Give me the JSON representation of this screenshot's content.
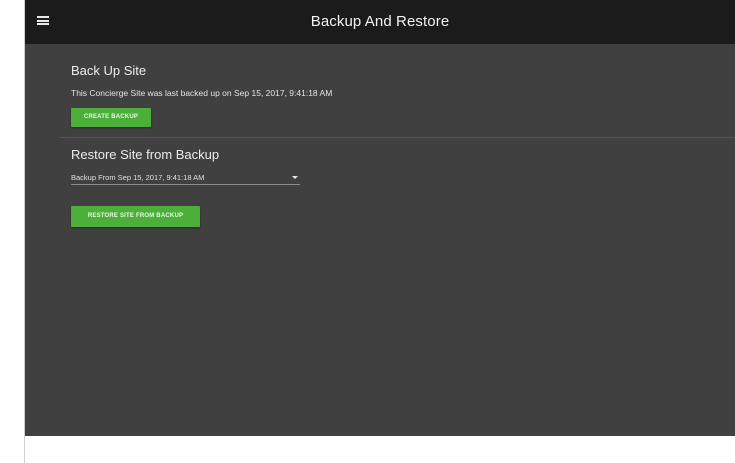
{
  "appbar": {
    "title": "Backup And Restore"
  },
  "backup_section": {
    "heading": "Back Up Site",
    "description": "This Concierge Site was last backed up on Sep 15, 2017, 9:41:18 AM",
    "button_label": "CREATE BACKUP"
  },
  "restore_section": {
    "heading": "Restore Site from Backup",
    "selected_backup": "Backup From Sep 15, 2017, 9:41:18 AM",
    "button_label": "RESTORE SITE FROM BACKUP"
  },
  "colors": {
    "appbar_bg": "#1b1b1b",
    "content_bg": "#404040",
    "button_green": "#4caf3a"
  },
  "icons": {
    "menu": "hamburger-menu-icon",
    "dropdown": "caret-down-icon"
  }
}
